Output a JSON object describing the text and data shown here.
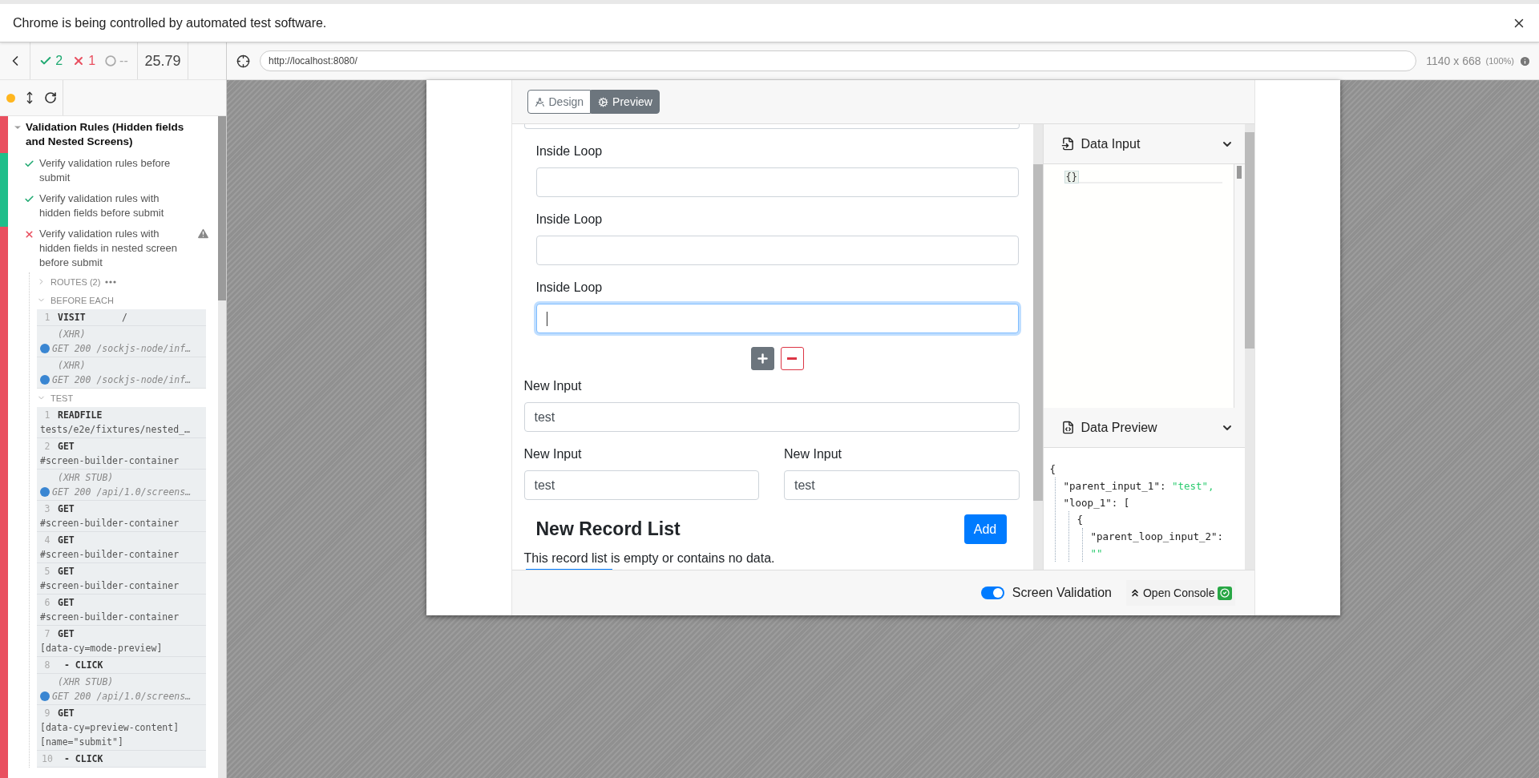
{
  "infobar": {
    "text": "Chrome is being controlled by automated test software."
  },
  "reporter": {
    "stats": {
      "passed": "2",
      "failed": "1",
      "pending": "--",
      "duration": "25.79"
    },
    "suite": {
      "title": "Validation Rules (Hidden fields and Nested Screens)",
      "tests": [
        {
          "title": "Verify validation rules before submit",
          "passed": true,
          "warning": false
        },
        {
          "title": "Verify validation rules with hidden fields before submit",
          "passed": true,
          "warning": false
        },
        {
          "title": "Verify validation rules with hidden fields in nested screen before submit",
          "passed": false,
          "warning": true
        }
      ],
      "sections": [
        {
          "title": "ROUTES (2)",
          "expanded": false
        },
        {
          "title": "BEFORE EACH",
          "expanded": true,
          "commands": [
            {
              "kind": "command",
              "number": "1",
              "name": "VISIT",
              "message": "/"
            },
            {
              "kind": "xhr",
              "label": "(XHR)",
              "message": "GET 200 /sockjs-node/inf…"
            },
            {
              "kind": "xhr",
              "label": "(XHR)",
              "message": "GET 200 /sockjs-node/inf…"
            }
          ]
        },
        {
          "title": "TEST",
          "expanded": true,
          "commands": [
            {
              "kind": "command",
              "number": "1",
              "name": "READFILE",
              "message": "tests/e2e/fixtures/nested_…"
            },
            {
              "kind": "command",
              "number": "2",
              "name": "GET",
              "message": "#screen-builder-container"
            },
            {
              "kind": "xhr",
              "label": "(XHR STUB)",
              "message": "GET 200 /api/1.0/screens…"
            },
            {
              "kind": "command",
              "number": "3",
              "name": "GET",
              "message": "#screen-builder-container"
            },
            {
              "kind": "command",
              "number": "4",
              "name": "GET",
              "message": "#screen-builder-container"
            },
            {
              "kind": "command",
              "number": "5",
              "name": "GET",
              "message": "#screen-builder-container"
            },
            {
              "kind": "command",
              "number": "6",
              "name": "GET",
              "message": "#screen-builder-container"
            },
            {
              "kind": "command",
              "number": "7",
              "name": "GET",
              "message": "[data-cy=mode-preview]"
            },
            {
              "kind": "child",
              "number": "8",
              "name": "- CLICK"
            },
            {
              "kind": "xhr",
              "label": "(XHR STUB)",
              "message": "GET 200 /api/1.0/screens…"
            },
            {
              "kind": "command",
              "number": "9",
              "name": "GET",
              "message": "[data-cy=preview-content] [name=\"submit\"]"
            },
            {
              "kind": "child",
              "number": "10",
              "name": "- CLICK"
            }
          ]
        }
      ]
    }
  },
  "url_bar": {
    "url": "http://localhost:8080/",
    "viewport": "1140 x 668",
    "zoom": "(100%)"
  },
  "builder": {
    "modes": [
      {
        "label": "Design",
        "selected": false
      },
      {
        "label": "Preview",
        "selected": true
      }
    ],
    "loop": [
      {
        "label": "Inside Loop",
        "focused": false
      },
      {
        "label": "Inside Loop",
        "focused": false
      },
      {
        "label": "Inside Loop",
        "focused": true
      }
    ],
    "field_rows": [
      [
        {
          "label": "New Input",
          "value": "test"
        }
      ],
      [
        {
          "label": "New Input",
          "value": "test"
        },
        {
          "label": "New Input",
          "value": "test"
        }
      ]
    ],
    "record_list": {
      "title": "New Record List",
      "add_button": "Add",
      "empty_message": "This record list is empty or contains no data."
    },
    "data_input": {
      "title": "Data Input",
      "content": "{}"
    },
    "data_preview": {
      "title": "Data Preview",
      "json": [
        {
          "text": "{",
          "children": [
            {
              "key": "\"parent_input_1\":",
              "value": "\"test\","
            },
            {
              "key": "\"loop_1\":",
              "text": "[",
              "children": [
                {
                  "text": "{",
                  "children": [
                    {
                      "key": "\"parent_loop_input_2\":",
                      "value": "\"\""
                    }
                  ]
                }
              ]
            }
          ]
        }
      ]
    },
    "footer": {
      "validation": {
        "label": "Screen Validation",
        "on": true
      },
      "console": {
        "label": "Open Console"
      }
    }
  }
}
